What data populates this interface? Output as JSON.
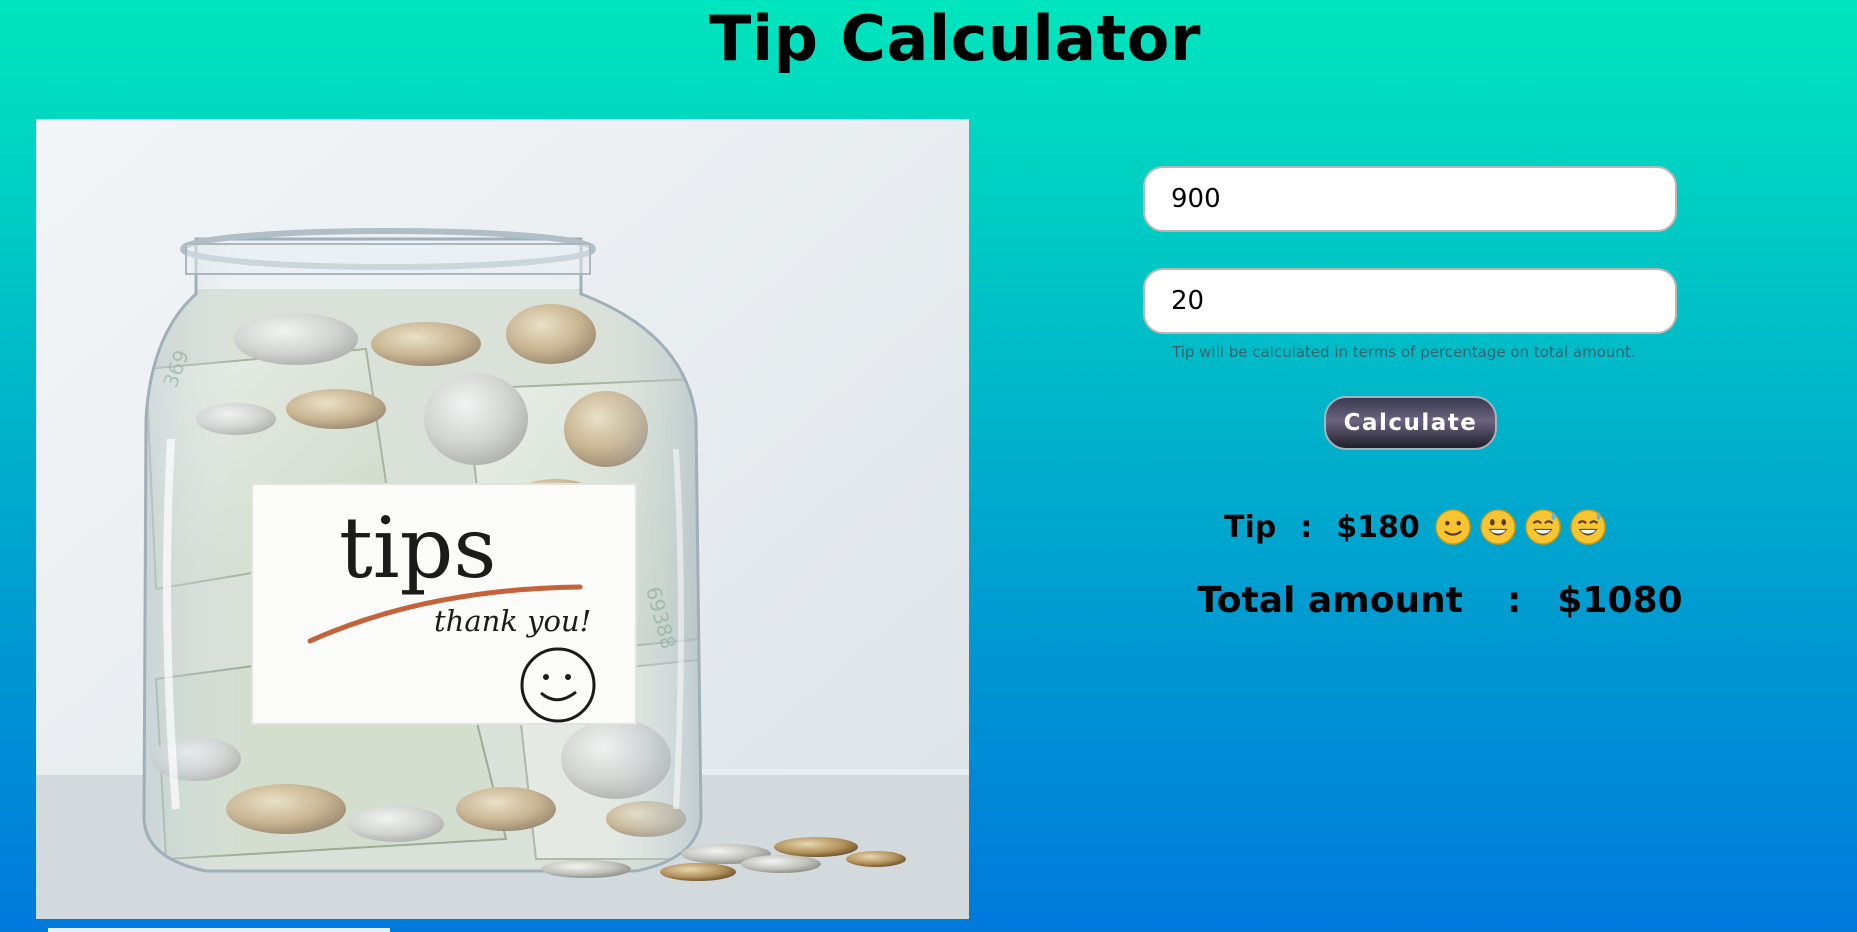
{
  "header": {
    "title": "Tip Calculator"
  },
  "image": {
    "label_word": "tips",
    "label_note": "thank you!",
    "bill_serial_1": "369",
    "bill_serial_2": "69388",
    "icon": "tip-jar-photo"
  },
  "form": {
    "bill_amount_value": "900",
    "tip_percent_value": "20",
    "tip_hint": "Tip will be calculated in terms of percentage on total amount.",
    "calculate_label": "Calculate"
  },
  "result": {
    "tip_label": "Tip",
    "tip_separator": ":",
    "tip_value": "$180",
    "total_label": "Total amount",
    "total_separator": ":",
    "total_value": "$1080",
    "emojis": [
      "slightly-smiling-face-icon",
      "grinning-face-icon",
      "grinning-sweat-face-icon",
      "grinning-sweat-face-icon"
    ]
  },
  "colors": {
    "background_top": "#00e6bd",
    "background_bottom": "#0079dc",
    "button_dark": "#2b2b3b"
  }
}
